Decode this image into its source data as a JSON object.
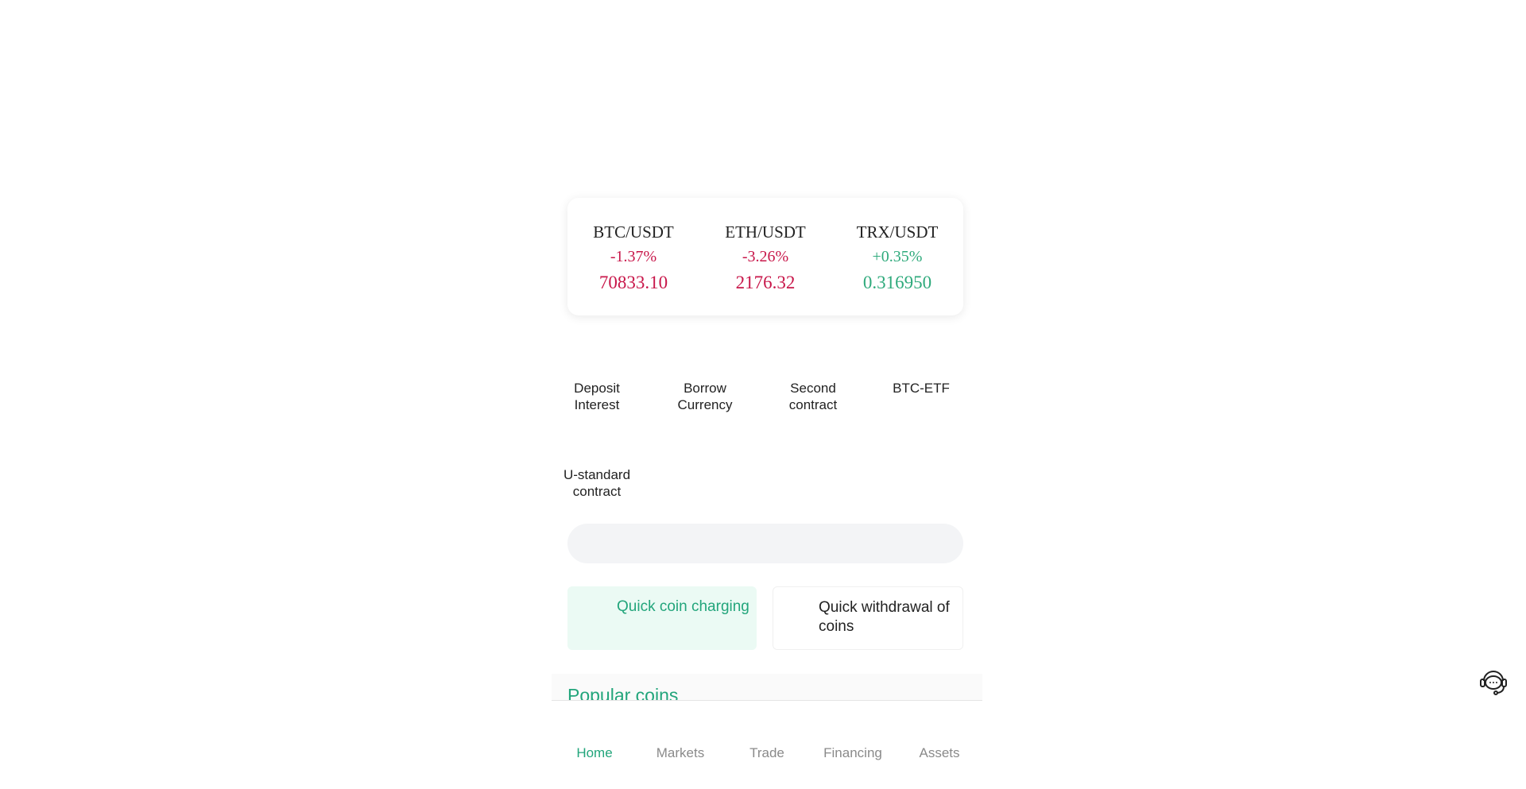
{
  "tickers": [
    {
      "pair": "BTC/USDT",
      "change": "-1.37%",
      "price": "70833.10",
      "trend": "down"
    },
    {
      "pair": "ETH/USDT",
      "change": "-3.26%",
      "price": "2176.32",
      "trend": "down"
    },
    {
      "pair": "TRX/USDT",
      "change": "+0.35%",
      "price": "0.316950",
      "trend": "up"
    }
  ],
  "menu": {
    "deposit_interest": "Deposit Interest",
    "borrow_currency": "Borrow Currency",
    "second_contract": "Second contract",
    "btc_etf": "BTC-ETF",
    "u_standard_contract": "U-standard contract"
  },
  "quick_actions": {
    "charge": "Quick coin charging",
    "withdraw": "Quick withdrawal of coins"
  },
  "popular": {
    "title": "Popular coins"
  },
  "nav": {
    "home": "Home",
    "markets": "Markets",
    "trade": "Trade",
    "financing": "Financing",
    "assets": "Assets"
  },
  "colors": {
    "accent": "#22a57b",
    "down": "#c8174a",
    "up": "#2faa7c"
  },
  "icons": {
    "support": "customer-service-headset-icon"
  }
}
